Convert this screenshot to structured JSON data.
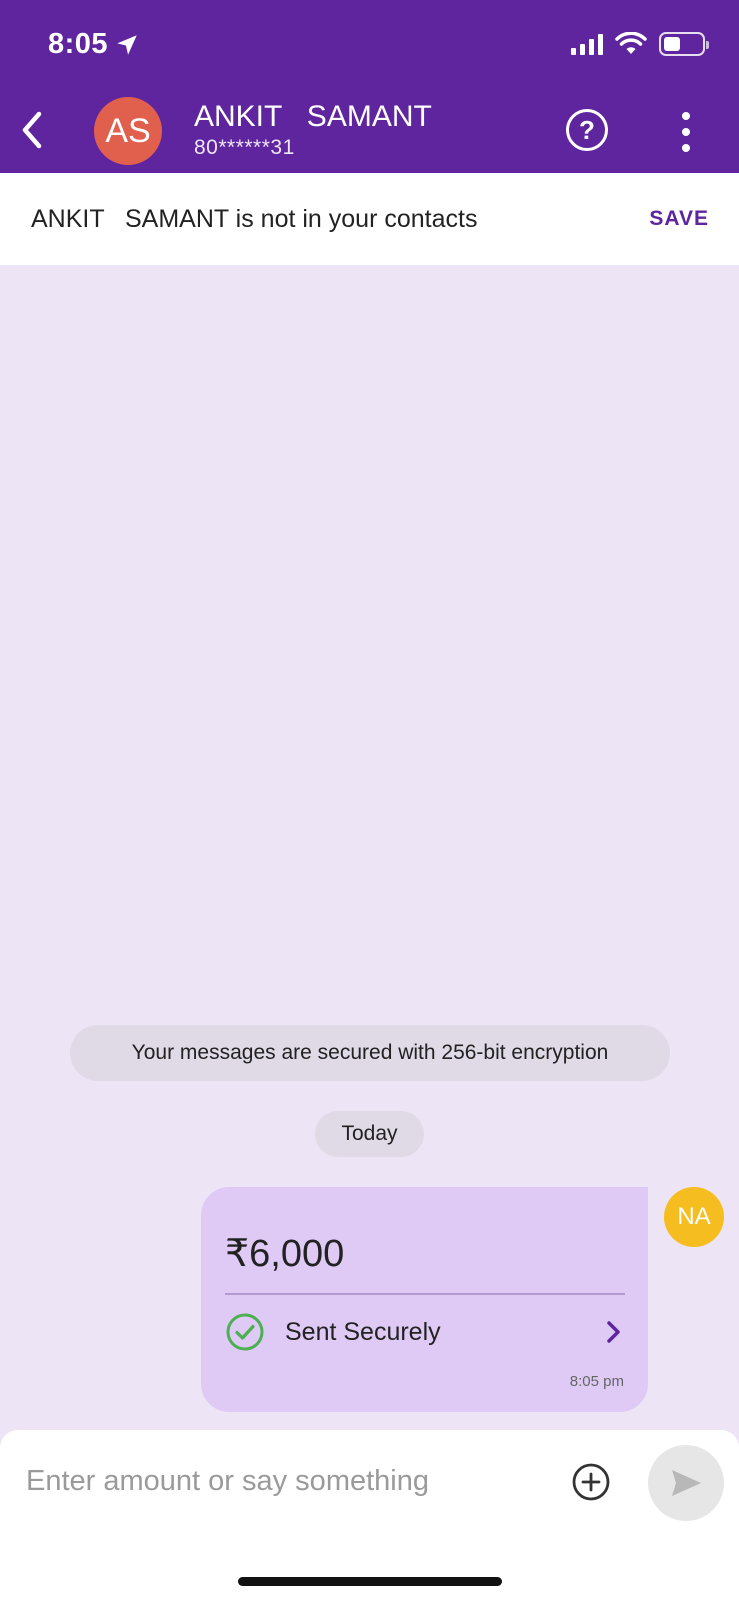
{
  "status_bar": {
    "time": "8:05",
    "location_icon": "location-arrow-icon",
    "signal_icon": "cellular-signal-icon",
    "wifi_icon": "wifi-icon",
    "battery_icon": "battery-icon",
    "battery_level": 0.45
  },
  "header": {
    "back_icon": "chevron-left-icon",
    "avatar_initials": "AS",
    "avatar_color": "#e1604d",
    "contact_name": "ANKIT   SAMANT",
    "contact_phone": "80******31",
    "help_icon": "help-circle-icon",
    "help_glyph": "?",
    "more_icon": "more-vertical-icon",
    "background_color": "#5e259f"
  },
  "contact_banner": {
    "text": "ANKIT   SAMANT is not in your contacts",
    "save_label": "SAVE"
  },
  "chat": {
    "background_color": "#ede5f5",
    "encryption_notice": "Your messages are secured with 256-bit encryption",
    "date_label": "Today",
    "payment": {
      "amount": "₹6,000",
      "status": "Sent Securely",
      "status_icon": "check-circle-icon",
      "chevron_icon": "chevron-right-icon",
      "time": "8:05 pm",
      "bubble_color": "#dfcaf6"
    },
    "sender_avatar": {
      "initials": "NA",
      "color": "#f5bd1f"
    }
  },
  "composer": {
    "placeholder": "Enter amount or say something",
    "add_icon": "plus-circle-icon",
    "send_icon": "send-icon"
  }
}
